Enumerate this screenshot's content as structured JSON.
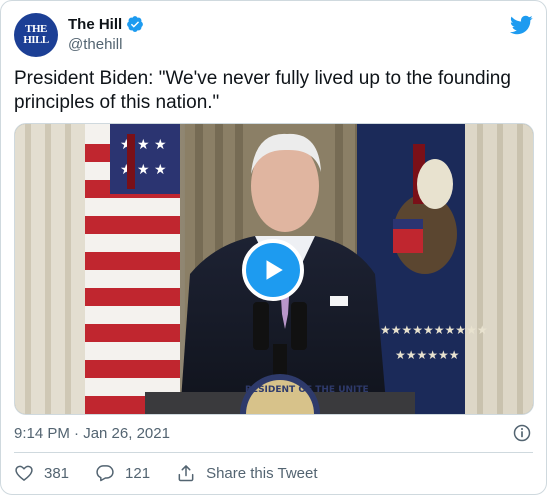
{
  "author": {
    "name": "The Hill",
    "handle": "@thehill",
    "avatar_text": [
      "THE",
      "HILL"
    ]
  },
  "tweet": {
    "text": "President Biden: \"We've never fully lived up to the founding principles of this nation.\"",
    "timestamp": "9:14 PM · Jan 26, 2021"
  },
  "actions": {
    "likes": "381",
    "replies": "121",
    "share_label": "Share this Tweet"
  },
  "media": {
    "seal_text": "RESIDENT OF THE UNITE"
  },
  "colors": {
    "accent": "#1d9bf0",
    "text": "#0f1419",
    "muted": "#536471"
  },
  "icons": [
    "verified-badge-icon",
    "twitter-bird-icon",
    "play-icon",
    "info-icon",
    "heart-icon",
    "reply-icon",
    "share-icon"
  ]
}
